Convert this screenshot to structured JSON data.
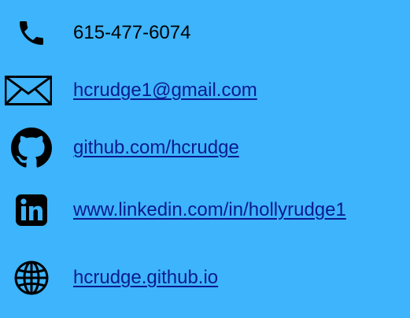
{
  "contacts": {
    "phone": {
      "text": "615-477-6074",
      "icon": "phone-icon"
    },
    "email": {
      "text": "hcrudge1@gmail.com",
      "icon": "envelope-icon"
    },
    "github": {
      "text": "github.com/hcrudge",
      "icon": "github-icon"
    },
    "linkedin": {
      "text": "www.linkedin.com/in/hollyrudge1",
      "icon": "linkedin-icon"
    },
    "website": {
      "text": "hcrudge.github.io",
      "icon": "globe-icon"
    }
  },
  "colors": {
    "background": "#3db4fb",
    "link": "#0b1a8f",
    "icon": "#000000"
  }
}
